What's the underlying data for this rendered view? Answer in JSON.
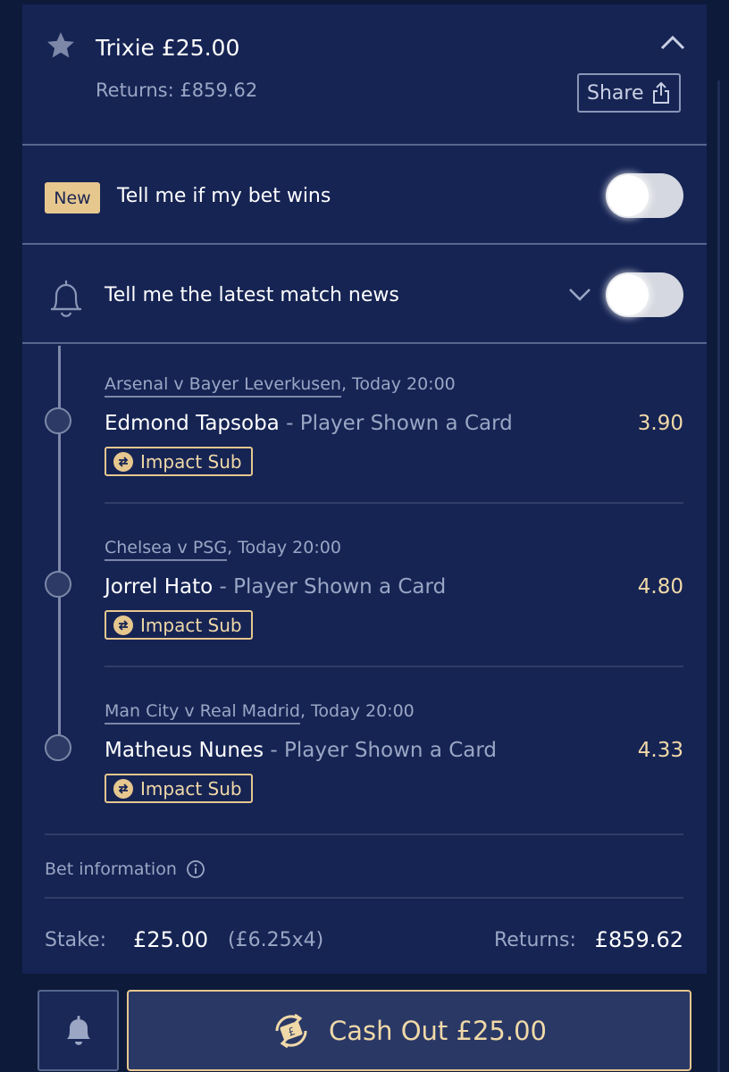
{
  "bet": {
    "type": "Trixie",
    "title": "Trixie £25.00",
    "returns": "Returns: £859.62",
    "share_label": "Share",
    "star_icon": "star-icon",
    "collapse_icon": "chevron-up-icon"
  },
  "notifications": {
    "new_badge": "New",
    "bet_wins_label": "Tell me if my bet wins",
    "bet_wins_on": false,
    "match_news_label": "Tell me the latest match news",
    "match_news_on": false
  },
  "selections": [
    {
      "match": "Arsenal v Bayer Leverkusen",
      "time": ", Today 20:00",
      "player": "Edmond Tapsoba",
      "market": " - Player Shown a Card",
      "odds": "3.90",
      "tag": "Impact Sub"
    },
    {
      "match": "Chelsea v PSG",
      "time": ", Today 20:00",
      "player": "Jorrel Hato",
      "market": " - Player Shown a Card",
      "odds": "4.80",
      "tag": "Impact Sub"
    },
    {
      "match": "Man City v Real Madrid",
      "time": ", Today 20:00",
      "player": "Matheus Nunes",
      "market": " - Player Shown a Card",
      "odds": "4.33",
      "tag": "Impact Sub"
    }
  ],
  "info": {
    "bet_information": "Bet information",
    "stake_label": "Stake:",
    "stake_value": "£25.00",
    "stake_split": "(£6.25x4)",
    "returns_label": "Returns:",
    "returns_value": "£859.62"
  },
  "footer": {
    "cashout_label": "Cash Out £25.00"
  },
  "colors": {
    "background": "#0e1a3a",
    "card": "#162454",
    "accent_gold": "#e6c78e",
    "muted_text": "#9aa6c4"
  }
}
